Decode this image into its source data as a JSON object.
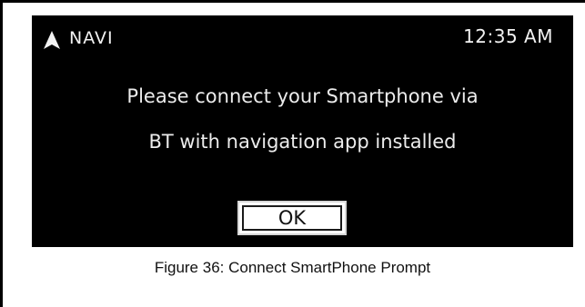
{
  "status_bar": {
    "app_label": "NAVI",
    "app_icon": "navigation-arrow-icon",
    "time": "12:35 AM"
  },
  "dialog": {
    "message_line1": "Please connect your Smartphone via",
    "message_line2": "BT with navigation app installed",
    "ok_label": "OK"
  },
  "caption": "Figure 36: Connect SmartPhone Prompt",
  "colors": {
    "screen_background": "#000000",
    "screen_text": "#ececec",
    "button_background": "#ffffff"
  }
}
